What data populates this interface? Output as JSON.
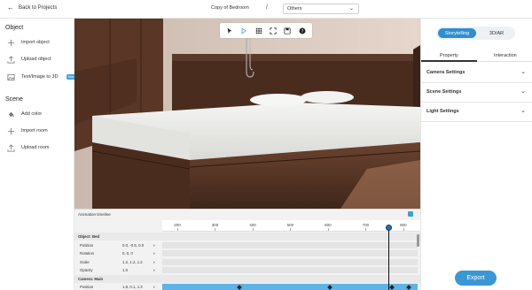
{
  "topbar": {
    "back_label": "Back to Projects",
    "project_name": "Copy of Bedroom",
    "separator": "/",
    "category_select": "Others"
  },
  "sidebar": {
    "object_title": "Object",
    "object_items": [
      {
        "label": "Import object",
        "icon": "plus-icon"
      },
      {
        "label": "Upload object",
        "icon": "upload-icon"
      },
      {
        "label": "Text/Image to 3D",
        "icon": "image-icon",
        "badge": "New"
      }
    ],
    "scene_title": "Scene",
    "scene_items": [
      {
        "label": "Add color",
        "icon": "paint-bucket-icon"
      },
      {
        "label": "Import room",
        "icon": "plus-icon"
      },
      {
        "label": "Upload room",
        "icon": "upload-icon"
      }
    ]
  },
  "viewport_toolbar": [
    "select-cursor-icon",
    "play-icon",
    "grid-icon",
    "expand-icon",
    "save-icon",
    "help-icon"
  ],
  "timeline": {
    "title": "Animation timeline",
    "ticks": [
      "200",
      "300",
      "400",
      "500",
      "600",
      "700",
      "800"
    ],
    "rows": [
      {
        "type": "group",
        "label": "Object: Bed"
      },
      {
        "type": "prop",
        "label": "Position",
        "values": "0.0,  -0.5,  0.0"
      },
      {
        "type": "prop",
        "label": "Rotation",
        "values": "0,     0,     0"
      },
      {
        "type": "prop",
        "label": "Scale",
        "values": "1.2,   1.2,   1.2"
      },
      {
        "type": "prop",
        "label": "Opacity",
        "values": "1.0"
      },
      {
        "type": "group",
        "label": "Camera: Main"
      },
      {
        "type": "prop",
        "label": "Position",
        "values": "1.8,   0.1,   1.3",
        "highlight": true
      }
    ],
    "playhead_frame": 770,
    "keyframes_frame": [
      365,
      605,
      770,
      815
    ]
  },
  "right_panel": {
    "mode_storytelling": "Storytelling",
    "mode_3dar": "3D/AR",
    "tab_property": "Property",
    "tab_interaction": "Interaction",
    "sections": [
      "Camera Settings",
      "Scene Settings",
      "Light Settings"
    ]
  },
  "export_label": "Export",
  "colors": {
    "accent": "#2e8fd0",
    "timeline_highlight": "#5fb3e6",
    "wood": "#5b3a2b"
  }
}
